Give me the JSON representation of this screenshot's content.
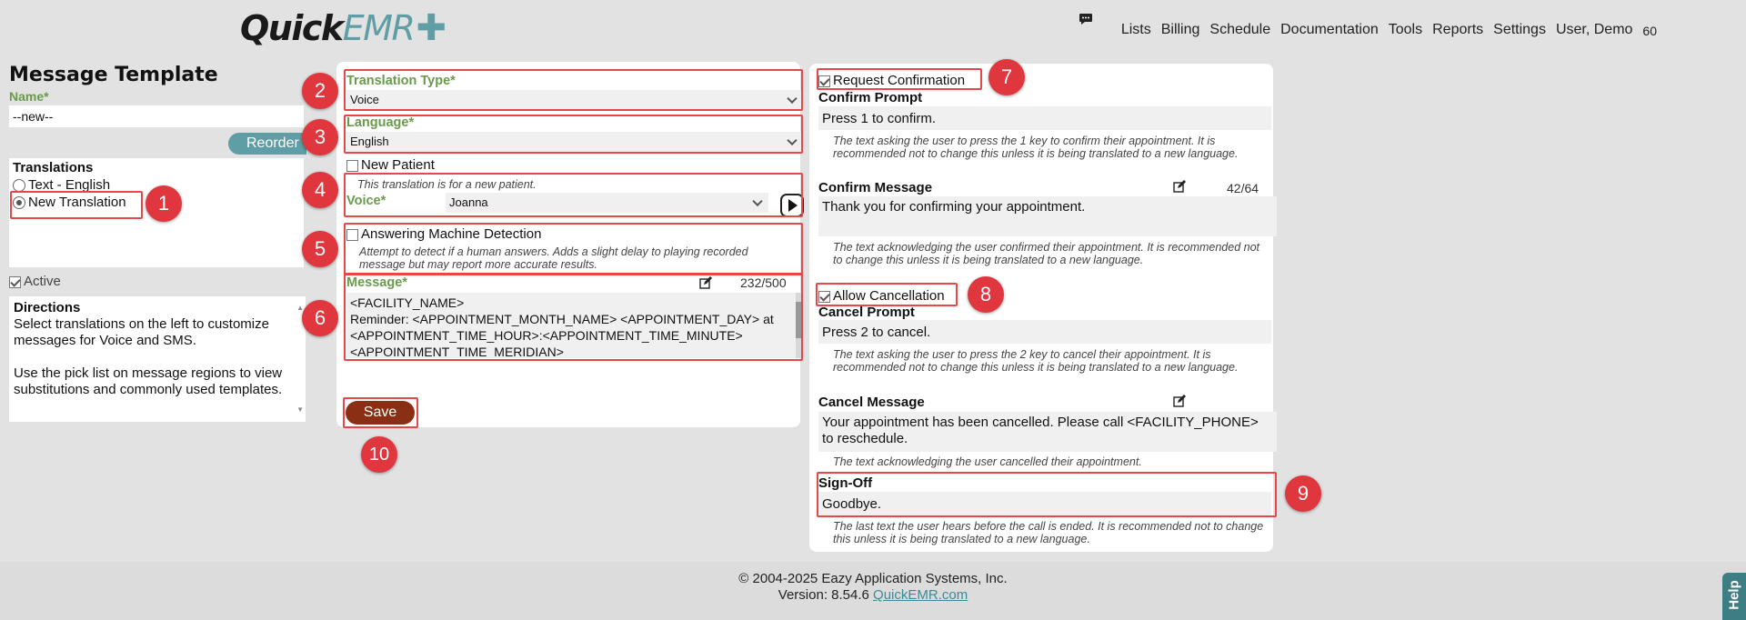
{
  "header": {
    "logo_quick": "Quick",
    "logo_emr": "EMR",
    "nav": [
      "Lists",
      "Billing",
      "Schedule",
      "Documentation",
      "Tools",
      "Reports",
      "Settings",
      "User, Demo",
      "60"
    ]
  },
  "left": {
    "title": "Message Template",
    "name_label": "Name*",
    "name_value": "--new--",
    "reorder_label": "Reorder",
    "translations_label": "Translations",
    "translations": [
      "Text - English",
      "New Translation"
    ],
    "active_label": "Active",
    "directions_title": "Directions",
    "directions_p1": "Select translations on the left to customize messages for Voice and SMS.",
    "directions_p2": "Use the pick list on message regions to view substitutions and commonly used templates."
  },
  "middle": {
    "translation_type_label": "Translation Type*",
    "translation_type_value": "Voice",
    "language_label": "Language*",
    "language_value": "English",
    "new_patient_label": "New Patient",
    "new_patient_hint": "This translation is for a new patient.",
    "voice_label": "Voice*",
    "voice_value": "Joanna",
    "amd_label": "Answering Machine Detection",
    "amd_hint": "Attempt to detect if a human answers. Adds a slight delay to playing recorded message but may report more accurate results.",
    "message_label": "Message*",
    "message_count": "232/500",
    "message_text": "<FACILITY_NAME>\nReminder: <APPOINTMENT_MONTH_NAME> <APPOINTMENT_DAY> at <APPOINTMENT_TIME_HOUR>:<APPOINTMENT_TIME_MINUTE> <APPOINTMENT_TIME_MERIDIAN>",
    "save_label": "Save"
  },
  "right": {
    "request_confirmation_label": "Request Confirmation",
    "confirm_prompt_label": "Confirm Prompt",
    "confirm_prompt_value": "Press 1 to confirm.",
    "confirm_prompt_hint": "The text asking the user to press the 1 key to confirm their appointment. It is recommended not to change this unless it is being translated to a new language.",
    "confirm_message_label": "Confirm Message",
    "confirm_message_count": "42/64",
    "confirm_message_value": "Thank you for confirming your appointment.",
    "confirm_message_hint": "The text acknowledging the user confirmed their appointment. It is recommended not to change this unless it is being translated to a new language.",
    "allow_cancellation_label": "Allow Cancellation",
    "cancel_prompt_label": "Cancel Prompt",
    "cancel_prompt_value": "Press 2 to cancel.",
    "cancel_prompt_hint": "The text asking the user to press the 2 key to cancel their appointment. It is recommended not to change this unless it is being translated to a new language.",
    "cancel_message_label": "Cancel Message",
    "cancel_message_value": "Your appointment has been cancelled. Please call <FACILITY_PHONE> to reschedule.",
    "cancel_message_hint": "The text acknowledging the user cancelled their appointment.",
    "signoff_label": "Sign-Off",
    "signoff_value": "Goodbye.",
    "signoff_hint": "The last text the user hears before the call is ended. It is recommended not to change this unless it is being translated to a new language."
  },
  "badges": [
    "1",
    "2",
    "3",
    "4",
    "5",
    "6",
    "7",
    "8",
    "9",
    "10"
  ],
  "footer": {
    "copyright": "© 2004-2025 Eazy Application Systems, Inc.",
    "version_prefix": "Version: 8.54.6 ",
    "link": "QuickEMR.com"
  },
  "help_tab": "Help",
  "colors": {
    "accent": "#5e9ea4",
    "label_green": "#6a9a4c",
    "annotation_red": "#e0363d",
    "save_button": "#8a2f14"
  }
}
